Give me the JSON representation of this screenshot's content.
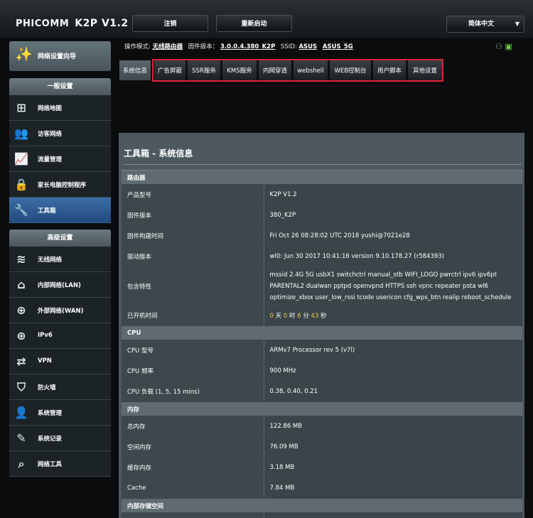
{
  "header": {
    "brand": "PHICOMM",
    "model": "K2P V1.2",
    "logout_label": "注销",
    "reboot_label": "重新启动",
    "language": "简体中文"
  },
  "sidebar": {
    "wizard_label": "网络设置向导",
    "general_title": "一般设置",
    "general_items": [
      {
        "label": "网络地图",
        "icon": "network-map-icon"
      },
      {
        "label": "访客网络",
        "icon": "guests-icon"
      },
      {
        "label": "流量管理",
        "icon": "traffic-icon"
      },
      {
        "label": "家长电脑控制程序",
        "icon": "lock-icon"
      },
      {
        "label": "工具箱",
        "icon": "wrench-icon"
      }
    ],
    "advanced_title": "高级设置",
    "advanced_items": [
      {
        "label": "无线网络",
        "icon": "wifi-icon"
      },
      {
        "label": "内部网络(LAN)",
        "icon": "home-icon"
      },
      {
        "label": "外部网络(WAN)",
        "icon": "globe-icon"
      },
      {
        "label": "IPv6",
        "icon": "globe-icon"
      },
      {
        "label": "VPN",
        "icon": "vpn-icon"
      },
      {
        "label": "防火墙",
        "icon": "shield-icon"
      },
      {
        "label": "系统管理",
        "icon": "user-icon"
      },
      {
        "label": "系统记录",
        "icon": "log-icon"
      },
      {
        "label": "网络工具",
        "icon": "search-icon"
      }
    ]
  },
  "status_line": {
    "mode_label": "操作模式:",
    "mode_value": "无线路由器",
    "fw_label": "固件版本：",
    "fw_value": "3.0.0.4.380_K2P",
    "ssid_label": "SSID:",
    "ssid1": "ASUS",
    "ssid2": "ASUS_5G"
  },
  "tabs": [
    "系统信息",
    "广告屏蔽",
    "SSR服务",
    "KMS服务",
    "内网穿透",
    "webshell",
    "WEB控制台",
    "用户脚本",
    "其他设置"
  ],
  "main": {
    "title": "工具箱 - 系统信息",
    "router_section": "路由器",
    "router_rows": [
      {
        "k": "产品型号",
        "v": "K2P V1.2"
      },
      {
        "k": "固件版本",
        "v": "380_K2P"
      },
      {
        "k": "固件构建时间",
        "v": "Fri Oct 26 08:28:02 UTC 2018 yushi@7021e28"
      },
      {
        "k": "驱动版本",
        "v": "wl0: Jun 30 2017 10:41:16 version 9.10.178.27 (r584393)"
      },
      {
        "k": "包含特性",
        "v1": "mssid 2.4G 5G usbX1 switchctrl manual_stb WIFI_LOGO pwrctrl ipv6 ipv6pt",
        "v2": "PARENTAL2 dualwan pptpd openvpnd HTTPS ssh vpnc repeater psta wl6",
        "v3": "optimize_xbox user_low_rssi tcode usericon cfg_wps_btn realip reboot_schedule"
      }
    ],
    "uptime": {
      "k": "已开机时间",
      "d": "0",
      "d_unit": "天",
      "h": "0",
      "h_unit": "时",
      "m": "6",
      "m_unit": "分",
      "s": "43",
      "s_unit": "秒"
    },
    "cpu_section": "CPU",
    "cpu_rows": [
      {
        "k": "CPU 型号",
        "v": "ARMv7 Processor rev 5 (v7l)"
      },
      {
        "k": "CPU 频率",
        "v": "900 MHz"
      },
      {
        "k": "CPU 负载 (1, 5, 15 mins)",
        "v": "0.38,  0.40,  0.21"
      }
    ],
    "mem_section": "内存",
    "mem_rows": [
      {
        "k": "总内存",
        "v": "122.86 MB"
      },
      {
        "k": "空闲内存",
        "v": "76.09 MB"
      },
      {
        "k": "缓存内存",
        "v": "3.18 MB"
      },
      {
        "k": "Cache",
        "v": "7.84 MB"
      }
    ],
    "storage_section": "内部存储空间"
  }
}
